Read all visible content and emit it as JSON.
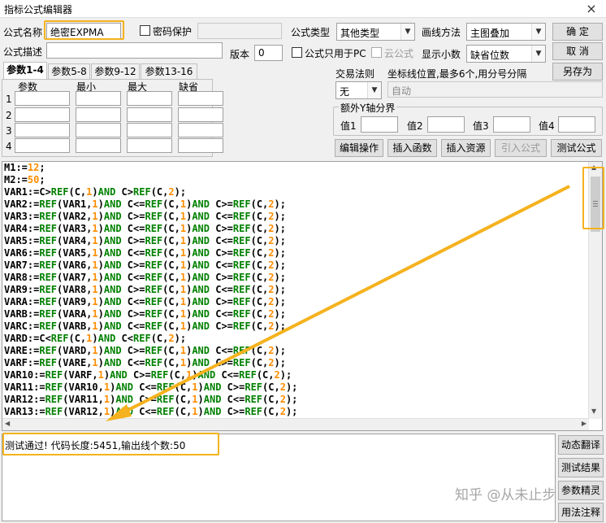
{
  "window": {
    "title": "指标公式编辑器",
    "close_glyph": "×"
  },
  "form": {
    "name_label": "公式名称",
    "name_value": "绝密EXPMA",
    "password_label": "密码保护",
    "desc_label": "公式描述",
    "version_label": "版本",
    "version_value": "0",
    "type_label": "公式类型",
    "type_value": "其他类型",
    "pc_only_label": "公式只用于PC",
    "cloud_label": "云公式",
    "draw_method_label": "画线方法",
    "draw_method_value": "主图叠加",
    "decimal_label": "显示小数",
    "decimal_value": "缺省位数",
    "trade_rule_label": "交易法则",
    "trade_rule_value": "无",
    "coord_label": "坐标线位置,最多6个,用分号分隔",
    "coord_placeholder": "自动",
    "y_axis_group_label": "额外Y轴分界",
    "y_values": [
      "值1",
      "值2",
      "值3",
      "值4"
    ]
  },
  "tabs": [
    "参数1-4",
    "参数5-8",
    "参数9-12",
    "参数13-16"
  ],
  "params": {
    "headers": [
      "参数",
      "最小",
      "最大",
      "缺省"
    ],
    "rows": [
      "1",
      "2",
      "3",
      "4"
    ]
  },
  "buttons": {
    "ok": "确  定",
    "cancel": "取  消",
    "save_as": "另存为",
    "edit_ops": "编辑操作",
    "insert_func": "插入函数",
    "insert_res": "插入资源",
    "import_formula": "引入公式",
    "test_formula": "测试公式"
  },
  "side_buttons": [
    "动态翻译",
    "测试结果",
    "参数精灵",
    "用法注释"
  ],
  "code_lines": [
    [
      [
        "n",
        "M1:="
      ],
      [
        "o",
        "12"
      ],
      [
        "n",
        ";"
      ]
    ],
    [
      [
        "n",
        "M2:="
      ],
      [
        "o",
        "50"
      ],
      [
        "n",
        ";"
      ]
    ],
    [
      [
        "n",
        "VAR1:=C>"
      ],
      [
        "g",
        "REF"
      ],
      [
        "n",
        "(C,"
      ],
      [
        "o",
        "1"
      ],
      [
        "n",
        ")"
      ],
      [
        "g",
        "AND"
      ],
      [
        "n",
        " C>"
      ],
      [
        "g",
        "REF"
      ],
      [
        "n",
        "(C,"
      ],
      [
        "o",
        "2"
      ],
      [
        "n",
        ");"
      ]
    ],
    [
      [
        "n",
        "VAR2:="
      ],
      [
        "g",
        "REF"
      ],
      [
        "n",
        "(VAR1,"
      ],
      [
        "o",
        "1"
      ],
      [
        "n",
        ")"
      ],
      [
        "g",
        "AND"
      ],
      [
        "n",
        " C<="
      ],
      [
        "g",
        "REF"
      ],
      [
        "n",
        "(C,"
      ],
      [
        "o",
        "1"
      ],
      [
        "n",
        ")"
      ],
      [
        "g",
        "AND"
      ],
      [
        "n",
        " C>="
      ],
      [
        "g",
        "REF"
      ],
      [
        "n",
        "(C,"
      ],
      [
        "o",
        "2"
      ],
      [
        "n",
        ");"
      ]
    ],
    [
      [
        "n",
        "VAR3:="
      ],
      [
        "g",
        "REF"
      ],
      [
        "n",
        "(VAR2,"
      ],
      [
        "o",
        "1"
      ],
      [
        "n",
        ")"
      ],
      [
        "g",
        "AND"
      ],
      [
        "n",
        " C>="
      ],
      [
        "g",
        "REF"
      ],
      [
        "n",
        "(C,"
      ],
      [
        "o",
        "1"
      ],
      [
        "n",
        ")"
      ],
      [
        "g",
        "AND"
      ],
      [
        "n",
        " C<="
      ],
      [
        "g",
        "REF"
      ],
      [
        "n",
        "(C,"
      ],
      [
        "o",
        "2"
      ],
      [
        "n",
        ");"
      ]
    ],
    [
      [
        "n",
        "VAR4:="
      ],
      [
        "g",
        "REF"
      ],
      [
        "n",
        "(VAR3,"
      ],
      [
        "o",
        "1"
      ],
      [
        "n",
        ")"
      ],
      [
        "g",
        "AND"
      ],
      [
        "n",
        " C<="
      ],
      [
        "g",
        "REF"
      ],
      [
        "n",
        "(C,"
      ],
      [
        "o",
        "1"
      ],
      [
        "n",
        ")"
      ],
      [
        "g",
        "AND"
      ],
      [
        "n",
        " C>="
      ],
      [
        "g",
        "REF"
      ],
      [
        "n",
        "(C,"
      ],
      [
        "o",
        "2"
      ],
      [
        "n",
        ");"
      ]
    ],
    [
      [
        "n",
        "VAR5:="
      ],
      [
        "g",
        "REF"
      ],
      [
        "n",
        "(VAR4,"
      ],
      [
        "o",
        "1"
      ],
      [
        "n",
        ")"
      ],
      [
        "g",
        "AND"
      ],
      [
        "n",
        " C>="
      ],
      [
        "g",
        "REF"
      ],
      [
        "n",
        "(C,"
      ],
      [
        "o",
        "1"
      ],
      [
        "n",
        ")"
      ],
      [
        "g",
        "AND"
      ],
      [
        "n",
        " C<="
      ],
      [
        "g",
        "REF"
      ],
      [
        "n",
        "(C,"
      ],
      [
        "o",
        "2"
      ],
      [
        "n",
        ");"
      ]
    ],
    [
      [
        "n",
        "VAR6:="
      ],
      [
        "g",
        "REF"
      ],
      [
        "n",
        "(VAR5,"
      ],
      [
        "o",
        "1"
      ],
      [
        "n",
        ")"
      ],
      [
        "g",
        "AND"
      ],
      [
        "n",
        " C<="
      ],
      [
        "g",
        "REF"
      ],
      [
        "n",
        "(C,"
      ],
      [
        "o",
        "1"
      ],
      [
        "n",
        ")"
      ],
      [
        "g",
        "AND"
      ],
      [
        "n",
        " C>="
      ],
      [
        "g",
        "REF"
      ],
      [
        "n",
        "(C,"
      ],
      [
        "o",
        "2"
      ],
      [
        "n",
        ");"
      ]
    ],
    [
      [
        "n",
        "VAR7:="
      ],
      [
        "g",
        "REF"
      ],
      [
        "n",
        "(VAR6,"
      ],
      [
        "o",
        "1"
      ],
      [
        "n",
        ")"
      ],
      [
        "g",
        "AND"
      ],
      [
        "n",
        " C>="
      ],
      [
        "g",
        "REF"
      ],
      [
        "n",
        "(C,"
      ],
      [
        "o",
        "1"
      ],
      [
        "n",
        ")"
      ],
      [
        "g",
        "AND"
      ],
      [
        "n",
        " C<="
      ],
      [
        "g",
        "REF"
      ],
      [
        "n",
        "(C,"
      ],
      [
        "o",
        "2"
      ],
      [
        "n",
        ");"
      ]
    ],
    [
      [
        "n",
        "VAR8:="
      ],
      [
        "g",
        "REF"
      ],
      [
        "n",
        "(VAR7,"
      ],
      [
        "o",
        "1"
      ],
      [
        "n",
        ")"
      ],
      [
        "g",
        "AND"
      ],
      [
        "n",
        " C<="
      ],
      [
        "g",
        "REF"
      ],
      [
        "n",
        "(C,"
      ],
      [
        "o",
        "1"
      ],
      [
        "n",
        ")"
      ],
      [
        "g",
        "AND"
      ],
      [
        "n",
        " C>="
      ],
      [
        "g",
        "REF"
      ],
      [
        "n",
        "(C,"
      ],
      [
        "o",
        "2"
      ],
      [
        "n",
        ");"
      ]
    ],
    [
      [
        "n",
        "VAR9:="
      ],
      [
        "g",
        "REF"
      ],
      [
        "n",
        "(VAR8,"
      ],
      [
        "o",
        "1"
      ],
      [
        "n",
        ")"
      ],
      [
        "g",
        "AND"
      ],
      [
        "n",
        " C>="
      ],
      [
        "g",
        "REF"
      ],
      [
        "n",
        "(C,"
      ],
      [
        "o",
        "1"
      ],
      [
        "n",
        ")"
      ],
      [
        "g",
        "AND"
      ],
      [
        "n",
        " C<="
      ],
      [
        "g",
        "REF"
      ],
      [
        "n",
        "(C,"
      ],
      [
        "o",
        "2"
      ],
      [
        "n",
        ");"
      ]
    ],
    [
      [
        "n",
        "VARA:="
      ],
      [
        "g",
        "REF"
      ],
      [
        "n",
        "(VAR9,"
      ],
      [
        "o",
        "1"
      ],
      [
        "n",
        ")"
      ],
      [
        "g",
        "AND"
      ],
      [
        "n",
        " C<="
      ],
      [
        "g",
        "REF"
      ],
      [
        "n",
        "(C,"
      ],
      [
        "o",
        "1"
      ],
      [
        "n",
        ")"
      ],
      [
        "g",
        "AND"
      ],
      [
        "n",
        " C>="
      ],
      [
        "g",
        "REF"
      ],
      [
        "n",
        "(C,"
      ],
      [
        "o",
        "2"
      ],
      [
        "n",
        ");"
      ]
    ],
    [
      [
        "n",
        "VARB:="
      ],
      [
        "g",
        "REF"
      ],
      [
        "n",
        "(VARA,"
      ],
      [
        "o",
        "1"
      ],
      [
        "n",
        ")"
      ],
      [
        "g",
        "AND"
      ],
      [
        "n",
        " C>="
      ],
      [
        "g",
        "REF"
      ],
      [
        "n",
        "(C,"
      ],
      [
        "o",
        "1"
      ],
      [
        "n",
        ")"
      ],
      [
        "g",
        "AND"
      ],
      [
        "n",
        " C<="
      ],
      [
        "g",
        "REF"
      ],
      [
        "n",
        "(C,"
      ],
      [
        "o",
        "2"
      ],
      [
        "n",
        ");"
      ]
    ],
    [
      [
        "n",
        "VARC:="
      ],
      [
        "g",
        "REF"
      ],
      [
        "n",
        "(VARB,"
      ],
      [
        "o",
        "1"
      ],
      [
        "n",
        ")"
      ],
      [
        "g",
        "AND"
      ],
      [
        "n",
        " C<="
      ],
      [
        "g",
        "REF"
      ],
      [
        "n",
        "(C,"
      ],
      [
        "o",
        "1"
      ],
      [
        "n",
        ")"
      ],
      [
        "g",
        "AND"
      ],
      [
        "n",
        " C>="
      ],
      [
        "g",
        "REF"
      ],
      [
        "n",
        "(C,"
      ],
      [
        "o",
        "2"
      ],
      [
        "n",
        ");"
      ]
    ],
    [
      [
        "n",
        "VARD:=C<"
      ],
      [
        "g",
        "REF"
      ],
      [
        "n",
        "(C,"
      ],
      [
        "o",
        "1"
      ],
      [
        "n",
        ")"
      ],
      [
        "g",
        "AND"
      ],
      [
        "n",
        " C<"
      ],
      [
        "g",
        "REF"
      ],
      [
        "n",
        "(C,"
      ],
      [
        "o",
        "2"
      ],
      [
        "n",
        ");"
      ]
    ],
    [
      [
        "n",
        "VARE:="
      ],
      [
        "g",
        "REF"
      ],
      [
        "n",
        "(VARD,"
      ],
      [
        "o",
        "1"
      ],
      [
        "n",
        ")"
      ],
      [
        "g",
        "AND"
      ],
      [
        "n",
        " C>="
      ],
      [
        "g",
        "REF"
      ],
      [
        "n",
        "(C,"
      ],
      [
        "o",
        "1"
      ],
      [
        "n",
        ")"
      ],
      [
        "g",
        "AND"
      ],
      [
        "n",
        " C<="
      ],
      [
        "g",
        "REF"
      ],
      [
        "n",
        "(C,"
      ],
      [
        "o",
        "2"
      ],
      [
        "n",
        ");"
      ]
    ],
    [
      [
        "n",
        "VARF:="
      ],
      [
        "g",
        "REF"
      ],
      [
        "n",
        "(VARE,"
      ],
      [
        "o",
        "1"
      ],
      [
        "n",
        ")"
      ],
      [
        "g",
        "AND"
      ],
      [
        "n",
        " C<="
      ],
      [
        "g",
        "REF"
      ],
      [
        "n",
        "(C,"
      ],
      [
        "o",
        "1"
      ],
      [
        "n",
        ")"
      ],
      [
        "g",
        "AND"
      ],
      [
        "n",
        " C>="
      ],
      [
        "g",
        "REF"
      ],
      [
        "n",
        "(C,"
      ],
      [
        "o",
        "2"
      ],
      [
        "n",
        ");"
      ]
    ],
    [
      [
        "n",
        "VAR10:="
      ],
      [
        "g",
        "REF"
      ],
      [
        "n",
        "(VARF,"
      ],
      [
        "o",
        "1"
      ],
      [
        "n",
        ")"
      ],
      [
        "g",
        "AND"
      ],
      [
        "n",
        " C>="
      ],
      [
        "g",
        "REF"
      ],
      [
        "n",
        "(C,"
      ],
      [
        "o",
        "1"
      ],
      [
        "n",
        ")"
      ],
      [
        "g",
        "AND"
      ],
      [
        "n",
        " C<="
      ],
      [
        "g",
        "REF"
      ],
      [
        "n",
        "(C,"
      ],
      [
        "o",
        "2"
      ],
      [
        "n",
        ");"
      ]
    ],
    [
      [
        "n",
        "VAR11:="
      ],
      [
        "g",
        "REF"
      ],
      [
        "n",
        "(VAR10,"
      ],
      [
        "o",
        "1"
      ],
      [
        "n",
        ")"
      ],
      [
        "g",
        "AND"
      ],
      [
        "n",
        " C<="
      ],
      [
        "g",
        "REF"
      ],
      [
        "n",
        "(C,"
      ],
      [
        "o",
        "1"
      ],
      [
        "n",
        ")"
      ],
      [
        "g",
        "AND"
      ],
      [
        "n",
        " C>="
      ],
      [
        "g",
        "REF"
      ],
      [
        "n",
        "(C,"
      ],
      [
        "o",
        "2"
      ],
      [
        "n",
        ");"
      ]
    ],
    [
      [
        "n",
        "VAR12:="
      ],
      [
        "g",
        "REF"
      ],
      [
        "n",
        "(VAR11,"
      ],
      [
        "o",
        "1"
      ],
      [
        "n",
        ")"
      ],
      [
        "g",
        "AND"
      ],
      [
        "n",
        " C>="
      ],
      [
        "g",
        "REF"
      ],
      [
        "n",
        "(C,"
      ],
      [
        "o",
        "1"
      ],
      [
        "n",
        ")"
      ],
      [
        "g",
        "AND"
      ],
      [
        "n",
        " C<="
      ],
      [
        "g",
        "REF"
      ],
      [
        "n",
        "(C,"
      ],
      [
        "o",
        "2"
      ],
      [
        "n",
        ");"
      ]
    ],
    [
      [
        "n",
        "VAR13:="
      ],
      [
        "g",
        "REF"
      ],
      [
        "n",
        "(VAR12,"
      ],
      [
        "o",
        "1"
      ],
      [
        "n",
        ")"
      ],
      [
        "g",
        "AND"
      ],
      [
        "n",
        " C<="
      ],
      [
        "g",
        "REF"
      ],
      [
        "n",
        "(C,"
      ],
      [
        "o",
        "1"
      ],
      [
        "n",
        ")"
      ],
      [
        "g",
        "AND"
      ],
      [
        "n",
        " C>="
      ],
      [
        "g",
        "REF"
      ],
      [
        "n",
        "(C,"
      ],
      [
        "o",
        "2"
      ],
      [
        "n",
        ");"
      ]
    ]
  ],
  "status_text": "测试通过! 代码长度:5451,输出线个数:50",
  "watermark": "知乎 @从未止步",
  "colors": {
    "highlight": "#f5b21e",
    "keyword": "#008000",
    "number": "#ff8c00"
  }
}
